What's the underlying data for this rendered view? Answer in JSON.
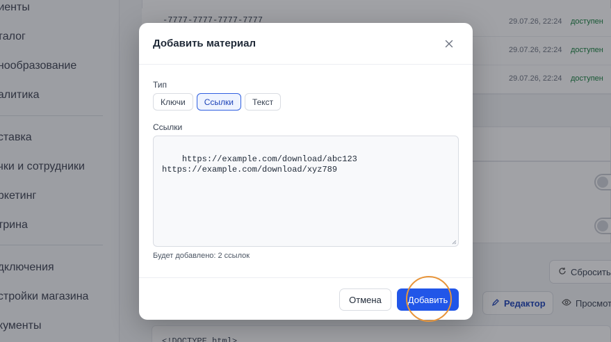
{
  "sidebar": {
    "items": [
      {
        "label": "лиенты"
      },
      {
        "label": "аталог"
      },
      {
        "label": "енообразование"
      },
      {
        "label": "налитика"
      },
      {
        "label": "оставка"
      },
      {
        "label": "очки и сотрудники"
      },
      {
        "label": "аркетинг"
      },
      {
        "label": "итрина"
      },
      {
        "label": "одключения"
      },
      {
        "label": "астройки магазина"
      },
      {
        "label": "окументы"
      }
    ]
  },
  "background": {
    "rows": [
      {
        "code": "-7777-7777-7777-7777",
        "date": "29.07.26, 22:24",
        "status": "доступен"
      },
      {
        "code": "",
        "date": "29.07.26, 22:24",
        "status": "доступен"
      },
      {
        "code": "",
        "date": "29.07.26, 22:24",
        "status": "доступен"
      }
    ],
    "reset_label": "Сбросить",
    "editor_label": "Редактор",
    "preview_label": "Просмотр",
    "code_preview": "<!DOCTYPE html>"
  },
  "modal": {
    "title": "Добавить материал",
    "type_label": "Тип",
    "type_options": [
      {
        "label": "Ключи",
        "active": false
      },
      {
        "label": "Ссылки",
        "active": true
      },
      {
        "label": "Текст",
        "active": false
      }
    ],
    "links_label": "Ссылки",
    "links_value": "https://example.com/download/abc123\nhttps://example.com/download/xyz789",
    "hint": "Будет добавлено: 2 ссылок",
    "cancel_label": "Отмена",
    "submit_label": "Добавить"
  },
  "colors": {
    "accent": "#2156e8",
    "status_ok": "#15803d",
    "click_marker": "#e8953a"
  },
  "icons": {
    "close": "close-icon",
    "reset": "refresh-icon",
    "editor": "pencil-icon",
    "preview": "eye-icon"
  }
}
